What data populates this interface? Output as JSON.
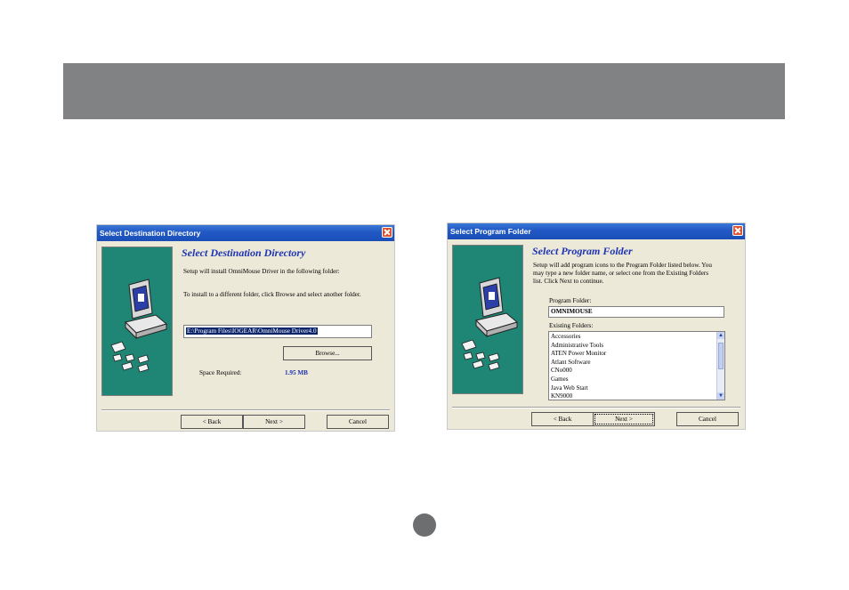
{
  "dialog1": {
    "title": "Select Destination Directory",
    "heading": "Select Destination Directory",
    "line1": "Setup will install OmniMouse Driver in the following folder:",
    "line2": "To install to a different folder, click Browse and select another folder.",
    "path_value": "E:\\Program Files\\IOGEAR\\OmniMouse Driver4.0",
    "browse_label": "Browse...",
    "space_label": "Space Required:",
    "space_value": "1.95 MB",
    "back_label": "< Back",
    "next_label": "Next >",
    "cancel_label": "Cancel"
  },
  "dialog2": {
    "title": "Select Program Folder",
    "heading": "Select Program Folder",
    "desc1": "Setup will add program icons to the Program Folder listed below. You",
    "desc2": "may type a new folder name, or select one from the Existing Folders",
    "desc3": "list.  Click Next to continue.",
    "program_folder_label": "Program Folder:",
    "program_folder_value": "OMNIMOUSE",
    "existing_folders_label": "Existing Folders:",
    "existing_folders": [
      "Accessories",
      "Administrative Tools",
      "ATEN Power Monitor",
      "Atlant Software",
      "CNo000",
      "Games",
      "Java Web Start",
      "KN9000"
    ],
    "back_label": "< Back",
    "next_label": "Next >",
    "cancel_label": "Cancel"
  },
  "colors": {
    "header_band": "#808284",
    "side_panel": "#1f8574",
    "heading_text": "#1e34b4",
    "titlebar": "#2158c4",
    "space_value": "#2030b0"
  },
  "icons": {
    "close": "close-icon",
    "setup_art": "computer-setup-icon"
  }
}
